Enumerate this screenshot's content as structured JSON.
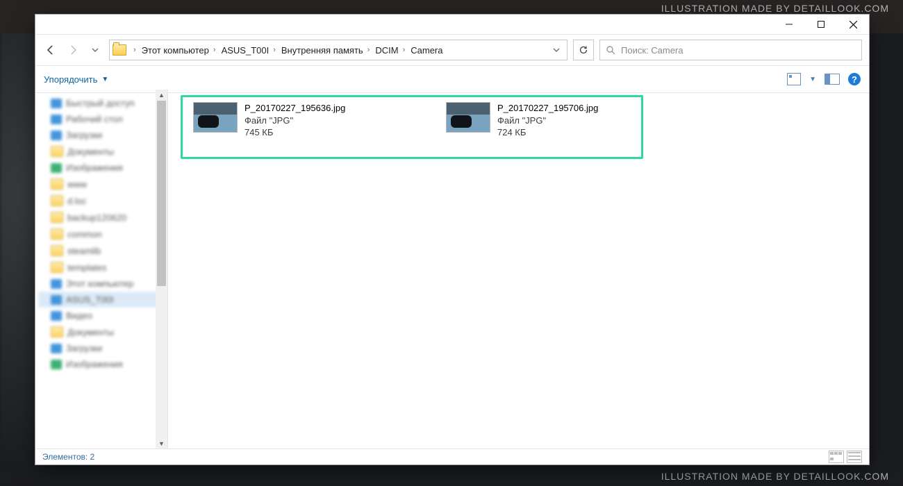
{
  "watermark_top": "ILLUSTRATION MADE BY DETAILLOOK.COM",
  "watermark_bottom": "ILLUSTRATION MADE BY DETAILLOOK.COM",
  "breadcrumb": [
    "Этот компьютер",
    "ASUS_T00I",
    "Внутренняя память",
    "DCIM",
    "Camera"
  ],
  "search_placeholder": "Поиск: Camera",
  "organize_label": "Упорядочить",
  "sidebar": [
    {
      "label": "Быстрый доступ",
      "ico": "blu"
    },
    {
      "label": "Рабочий стол",
      "ico": "blu"
    },
    {
      "label": "Загрузки",
      "ico": "blu"
    },
    {
      "label": "Документы",
      "ico": "fld"
    },
    {
      "label": "Изображения",
      "ico": "grn"
    },
    {
      "label": "www",
      "ico": "fld"
    },
    {
      "label": "d.loc",
      "ico": "fld"
    },
    {
      "label": "backup120620",
      "ico": "fld"
    },
    {
      "label": "common",
      "ico": "fld"
    },
    {
      "label": "steamlib",
      "ico": "fld"
    },
    {
      "label": "templates",
      "ico": "fld"
    },
    {
      "label": "Этот компьютер",
      "ico": "blu"
    },
    {
      "label": "ASUS_T00I",
      "ico": "blu",
      "selected": true
    },
    {
      "label": "Видео",
      "ico": "blu"
    },
    {
      "label": "Документы",
      "ico": "fld"
    },
    {
      "label": "Загрузки",
      "ico": "blu"
    },
    {
      "label": "Изображения",
      "ico": "grn"
    }
  ],
  "files": [
    {
      "name": "P_20170227_195636.jpg",
      "type": "Файл \"JPG\"",
      "size": "745 КБ"
    },
    {
      "name": "P_20170227_195706.jpg",
      "type": "Файл \"JPG\"",
      "size": "724 КБ"
    }
  ],
  "status_text": "Элементов: 2"
}
